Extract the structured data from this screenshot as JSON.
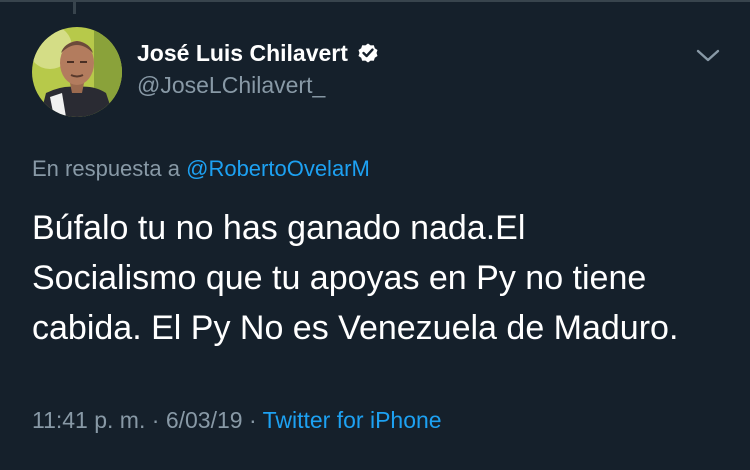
{
  "colors": {
    "background": "#15202b",
    "primary_text": "#ffffff",
    "secondary_text": "#8899a6",
    "accent": "#1da1f2"
  },
  "author": {
    "display_name": "José Luis Chilavert",
    "handle": "@JoseLChilavert_",
    "verified": true,
    "avatar_icon": "profile-photo",
    "verified_icon": "verified-badge-icon"
  },
  "menu_icon": "chevron-down-icon",
  "reply": {
    "prefix": "En respuesta a ",
    "username": "@RobertoOvelarM"
  },
  "tweet": {
    "lines": [
      "Búfalo tu no has ganado nada.El",
      "Socialismo que tu apoyas en Py no tiene",
      "cabida. El Py No es Venezuela de Maduro."
    ]
  },
  "meta": {
    "time": "11:41 p. m.",
    "separator": " · ",
    "date": "6/03/19",
    "source": "Twitter for iPhone"
  }
}
